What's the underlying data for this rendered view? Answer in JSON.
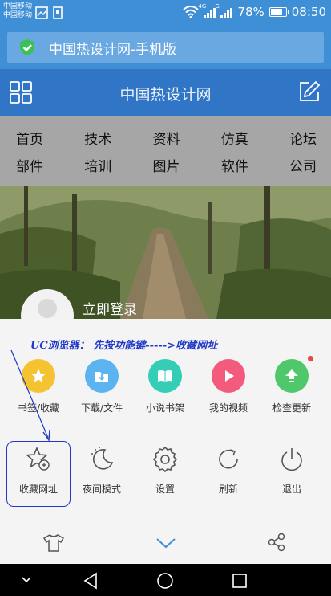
{
  "status_bar": {
    "carrier_1": "中国移动",
    "carrier_2": "中国移动",
    "network_1": "4G",
    "network_2": "G",
    "battery": "78%",
    "time": "08:50"
  },
  "address_bar": {
    "text": "中国热设计网-手机版",
    "icon": "shield-check-icon",
    "color": "#3f8fd7"
  },
  "site_header": {
    "title": "中国热设计网",
    "left_icon": "grid-icon",
    "right_icon": "edit-icon",
    "color": "#3175c7"
  },
  "nav": {
    "row1": [
      "首页",
      "技术",
      "资料",
      "仿真",
      "论坛"
    ],
    "row2": [
      "部件",
      "培训",
      "图片",
      "软件",
      "公司"
    ]
  },
  "profile": {
    "login_label": "立即登录"
  },
  "annotation": "UC浏览器：  先按功能键----->收藏网址",
  "menu": {
    "row1": [
      {
        "label": "书签/收藏",
        "icon": "star-icon",
        "color": "#f5c232"
      },
      {
        "label": "下载/文件",
        "icon": "download-icon",
        "color": "#5bb3f0"
      },
      {
        "label": "小说书架",
        "icon": "book-icon",
        "color": "#34cdb5"
      },
      {
        "label": "我的视频",
        "icon": "play-icon",
        "color": "#f25b7b"
      },
      {
        "label": "检查更新",
        "icon": "upgrade-icon",
        "color": "#4fc86b"
      }
    ],
    "row2": [
      {
        "label": "收藏网址",
        "icon": "star-add-icon"
      },
      {
        "label": "夜间模式",
        "icon": "moon-icon"
      },
      {
        "label": "设置",
        "icon": "gear-icon"
      },
      {
        "label": "刷新",
        "icon": "refresh-icon"
      },
      {
        "label": "退出",
        "icon": "power-icon"
      }
    ]
  },
  "bottom_bar": {
    "icons": [
      "shirt-icon",
      "chevron-down-icon",
      "share-icon"
    ],
    "accent": "#3f8fd7"
  },
  "system_nav": {
    "icons": [
      "hide-icon",
      "back-icon",
      "home-icon",
      "recent-icon"
    ]
  }
}
